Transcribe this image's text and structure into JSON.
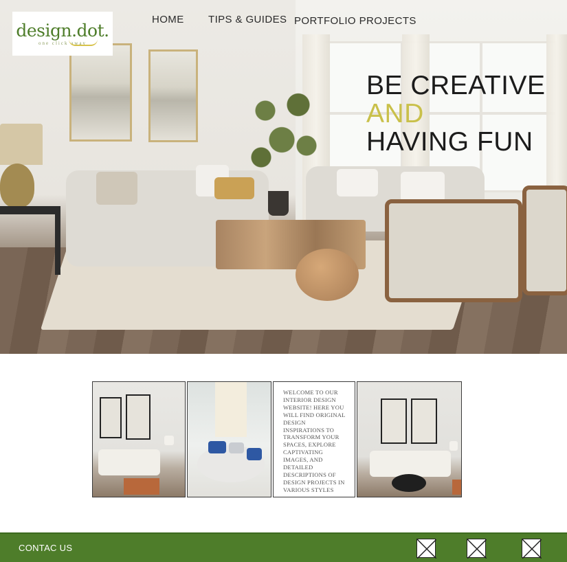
{
  "logo": {
    "name": "design.dot.",
    "tagline": "one click away"
  },
  "nav": {
    "items": [
      "HOME",
      "TIPS & GUIDES",
      "PORTFOLIO PROJECTS"
    ]
  },
  "hero": {
    "line1": "BE CREATIVE",
    "line2": "AND",
    "line3": "HAVING FUN"
  },
  "intro_text": "WELCOME TO OUR INTERIOR DESIGN WEBSITE! HERE YOU WILL FIND ORIGINAL DESIGN INSPIRATIONS TO TRANSFORM YOUR SPACES, EXPLORE CAPTIVATING IMAGES, AND DETAILED DESCRIPTIONS OF DESIGN PROJECTS IN VARIOUS STYLES",
  "footer": {
    "contact_label": "CONTAC US",
    "social_icons": [
      "broken-image-icon",
      "broken-image-icon",
      "broken-image-icon"
    ]
  },
  "colors": {
    "brand_green": "#4e7d2a",
    "accent_yellow": "#c9c04a",
    "headline_dark": "#1c1c1c"
  }
}
